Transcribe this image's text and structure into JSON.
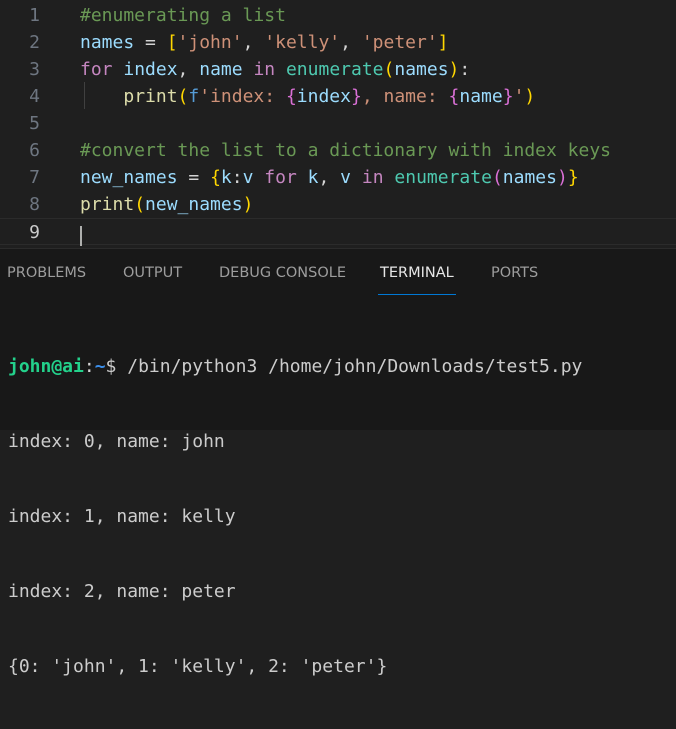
{
  "editor": {
    "lines": [
      {
        "number": "1",
        "tokens": [
          {
            "t": "#enumerating a list",
            "c": "cm"
          }
        ]
      },
      {
        "number": "2",
        "tokens": [
          {
            "t": "names",
            "c": "vr"
          },
          {
            "t": " = ",
            "c": "op"
          },
          {
            "t": "[",
            "c": "b1"
          },
          {
            "t": "'john'",
            "c": "st"
          },
          {
            "t": ", ",
            "c": "op"
          },
          {
            "t": "'kelly'",
            "c": "st"
          },
          {
            "t": ", ",
            "c": "op"
          },
          {
            "t": "'peter'",
            "c": "st"
          },
          {
            "t": "]",
            "c": "b1"
          }
        ]
      },
      {
        "number": "3",
        "tokens": [
          {
            "t": "for",
            "c": "kw"
          },
          {
            "t": " ",
            "c": "op"
          },
          {
            "t": "index",
            "c": "vr"
          },
          {
            "t": ", ",
            "c": "op"
          },
          {
            "t": "name",
            "c": "vr"
          },
          {
            "t": " ",
            "c": "op"
          },
          {
            "t": "in",
            "c": "kw"
          },
          {
            "t": " ",
            "c": "op"
          },
          {
            "t": "enumerate",
            "c": "bl"
          },
          {
            "t": "(",
            "c": "b1"
          },
          {
            "t": "names",
            "c": "vr"
          },
          {
            "t": ")",
            "c": "b1"
          },
          {
            "t": ":",
            "c": "op"
          }
        ]
      },
      {
        "number": "4",
        "tokens": [
          {
            "t": "    ",
            "c": "op"
          },
          {
            "t": "print",
            "c": "fn"
          },
          {
            "t": "(",
            "c": "b1"
          },
          {
            "t": "f",
            "c": "py"
          },
          {
            "t": "'index: ",
            "c": "st"
          },
          {
            "t": "{",
            "c": "b2"
          },
          {
            "t": "index",
            "c": "vr"
          },
          {
            "t": "}",
            "c": "b2"
          },
          {
            "t": ", name: ",
            "c": "st"
          },
          {
            "t": "{",
            "c": "b2"
          },
          {
            "t": "name",
            "c": "vr"
          },
          {
            "t": "}",
            "c": "b2"
          },
          {
            "t": "'",
            "c": "st"
          },
          {
            "t": ")",
            "c": "b1"
          }
        ]
      },
      {
        "number": "5",
        "tokens": []
      },
      {
        "number": "6",
        "tokens": [
          {
            "t": "#convert the list to a dictionary with index keys",
            "c": "cm"
          }
        ]
      },
      {
        "number": "7",
        "tokens": [
          {
            "t": "new_names",
            "c": "vr"
          },
          {
            "t": " = ",
            "c": "op"
          },
          {
            "t": "{",
            "c": "b1"
          },
          {
            "t": "k",
            "c": "vr"
          },
          {
            "t": ":",
            "c": "op"
          },
          {
            "t": "v",
            "c": "vr"
          },
          {
            "t": " ",
            "c": "op"
          },
          {
            "t": "for",
            "c": "kw"
          },
          {
            "t": " ",
            "c": "op"
          },
          {
            "t": "k",
            "c": "vr"
          },
          {
            "t": ", ",
            "c": "op"
          },
          {
            "t": "v",
            "c": "vr"
          },
          {
            "t": " ",
            "c": "op"
          },
          {
            "t": "in",
            "c": "kw"
          },
          {
            "t": " ",
            "c": "op"
          },
          {
            "t": "enumerate",
            "c": "bl"
          },
          {
            "t": "(",
            "c": "b2"
          },
          {
            "t": "names",
            "c": "vr"
          },
          {
            "t": ")",
            "c": "b2"
          },
          {
            "t": "}",
            "c": "b1"
          }
        ]
      },
      {
        "number": "8",
        "tokens": [
          {
            "t": "print",
            "c": "fn"
          },
          {
            "t": "(",
            "c": "b1"
          },
          {
            "t": "new_names",
            "c": "vr"
          },
          {
            "t": ")",
            "c": "b1"
          }
        ]
      },
      {
        "number": "9",
        "tokens": []
      }
    ]
  },
  "panel": {
    "tabs": [
      {
        "label": "PROBLEMS",
        "active": false
      },
      {
        "label": "OUTPUT",
        "active": false
      },
      {
        "label": "DEBUG CONSOLE",
        "active": false
      },
      {
        "label": "TERMINAL",
        "active": true
      },
      {
        "label": "PORTS",
        "active": false
      }
    ]
  },
  "terminal": {
    "prompt_user": "john@ai",
    "prompt_sep": ":",
    "prompt_path": "~",
    "prompt_symbol": "$ ",
    "command": "/bin/python3 /home/john/Downloads/test5.py",
    "output": [
      "index: 0, name: john",
      "index: 1, name: kelly",
      "index: 2, name: peter",
      "{0: 'john', 1: 'kelly', 2: 'peter'}"
    ]
  },
  "colors": {
    "editor_bg": "#1f1f1f",
    "panel_bg": "#181818",
    "active_tab_underline": "#0078d4",
    "prompt_user": "#23d18b",
    "prompt_path": "#3b8eea"
  }
}
